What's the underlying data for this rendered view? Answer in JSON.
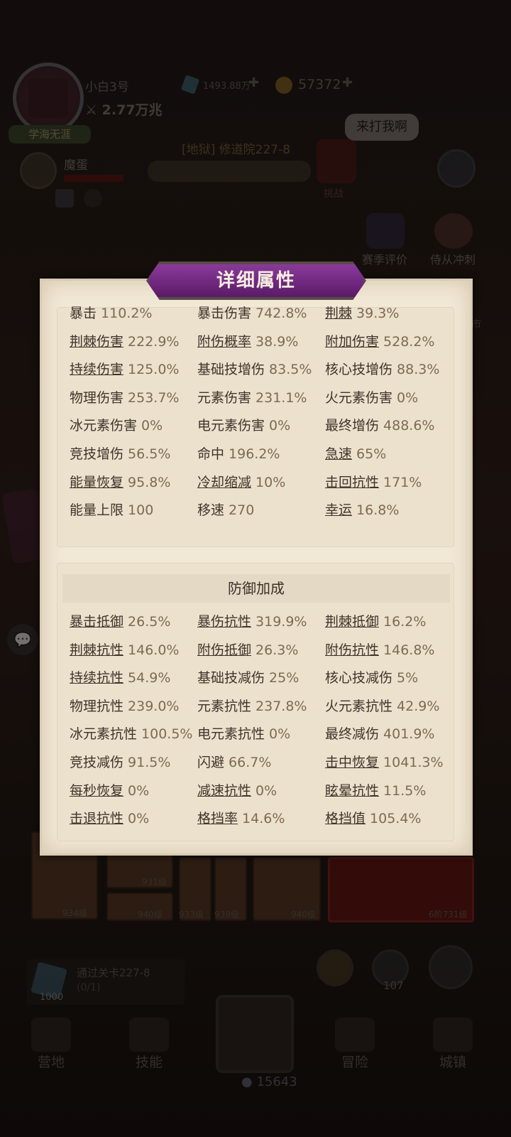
{
  "player": {
    "name": "小白3号",
    "power": "2.77万兆",
    "title": "学海无涯",
    "gems": "1493.88万",
    "gold": "57372"
  },
  "pet": {
    "name": "魔蛋"
  },
  "stage": {
    "name": "[地狱] 修道院227-8",
    "challenge_label": "挑战",
    "boss_bubble": "来打我啊"
  },
  "side_buttons": {
    "season_label": "赛季评价",
    "sprint_label": "侍从冲刺",
    "market_label": "市"
  },
  "equipment_levels": [
    "931级",
    "934级",
    "940级",
    "933级",
    "939级",
    "940级",
    "6阶731级"
  ],
  "quest": {
    "text": "通过关卡227-8",
    "count": "(0/1)",
    "reward": "1000"
  },
  "buttons": {
    "upgrade_count": "107"
  },
  "nav": {
    "camp": "营地",
    "skills": "技能",
    "adventure": "冒险",
    "town": "城镇",
    "currency": "15643"
  },
  "modal": {
    "title": "详细属性",
    "attack_stats": [
      {
        "label": "暴击",
        "value": "110.2%",
        "link": false
      },
      {
        "label": "暴击伤害",
        "value": "742.8%",
        "link": false
      },
      {
        "label": "荆棘",
        "value": "39.3%",
        "link": true
      },
      {
        "label": "荆棘伤害",
        "value": "222.9%",
        "link": true
      },
      {
        "label": "附伤概率",
        "value": "38.9%",
        "link": true
      },
      {
        "label": "附加伤害",
        "value": "528.2%",
        "link": true
      },
      {
        "label": "持续伤害",
        "value": "125.0%",
        "link": true
      },
      {
        "label": "基础技增伤",
        "value": "83.5%",
        "link": false
      },
      {
        "label": "核心技增伤",
        "value": "88.3%",
        "link": false
      },
      {
        "label": "物理伤害",
        "value": "253.7%",
        "link": false
      },
      {
        "label": "元素伤害",
        "value": "231.1%",
        "link": false
      },
      {
        "label": "火元素伤害",
        "value": "0%",
        "link": false
      },
      {
        "label": "冰元素伤害",
        "value": "0%",
        "link": false
      },
      {
        "label": "电元素伤害",
        "value": "0%",
        "link": false
      },
      {
        "label": "最终增伤",
        "value": "488.6%",
        "link": false
      },
      {
        "label": "竞技增伤",
        "value": "56.5%",
        "link": false
      },
      {
        "label": "命中",
        "value": "196.2%",
        "link": false
      },
      {
        "label": "急速",
        "value": "65%",
        "link": true
      },
      {
        "label": "能量恢复",
        "value": "95.8%",
        "link": true
      },
      {
        "label": "冷却缩减",
        "value": "10%",
        "link": true
      },
      {
        "label": "击回抗性",
        "value": "171%",
        "link": true
      },
      {
        "label": "能量上限",
        "value": "100",
        "link": false
      },
      {
        "label": "移速",
        "value": "270",
        "link": false
      },
      {
        "label": "幸运",
        "value": "16.8%",
        "link": true
      }
    ],
    "defense_title": "防御加成",
    "defense_stats": [
      {
        "label": "暴击抵御",
        "value": "26.5%",
        "link": true
      },
      {
        "label": "暴伤抗性",
        "value": "319.9%",
        "link": true
      },
      {
        "label": "荆棘抵御",
        "value": "16.2%",
        "link": true
      },
      {
        "label": "荆棘抗性",
        "value": "146.0%",
        "link": true
      },
      {
        "label": "附伤抵御",
        "value": "26.3%",
        "link": true
      },
      {
        "label": "附伤抗性",
        "value": "146.8%",
        "link": true
      },
      {
        "label": "持续抗性",
        "value": "54.9%",
        "link": true
      },
      {
        "label": "基础技减伤",
        "value": "25%",
        "link": false
      },
      {
        "label": "核心技减伤",
        "value": "5%",
        "link": false
      },
      {
        "label": "物理抗性",
        "value": "239.0%",
        "link": false
      },
      {
        "label": "元素抗性",
        "value": "237.8%",
        "link": false
      },
      {
        "label": "火元素抗性",
        "value": "42.9%",
        "link": false
      },
      {
        "label": "冰元素抗性",
        "value": "100.5%",
        "link": false
      },
      {
        "label": "电元素抗性",
        "value": "0%",
        "link": false
      },
      {
        "label": "最终减伤",
        "value": "401.9%",
        "link": false
      },
      {
        "label": "竞技减伤",
        "value": "91.5%",
        "link": false
      },
      {
        "label": "闪避",
        "value": "66.7%",
        "link": false
      },
      {
        "label": "击中恢复",
        "value": "1041.3%",
        "link": true
      },
      {
        "label": "每秒恢复",
        "value": "0%",
        "link": true
      },
      {
        "label": "减速抗性",
        "value": "0%",
        "link": true
      },
      {
        "label": "眩晕抗性",
        "value": "11.5%",
        "link": true
      },
      {
        "label": "击退抗性",
        "value": "0%",
        "link": true
      },
      {
        "label": "格挡率",
        "value": "14.6%",
        "link": true
      },
      {
        "label": "格挡值",
        "value": "105.4%",
        "link": true
      }
    ]
  }
}
